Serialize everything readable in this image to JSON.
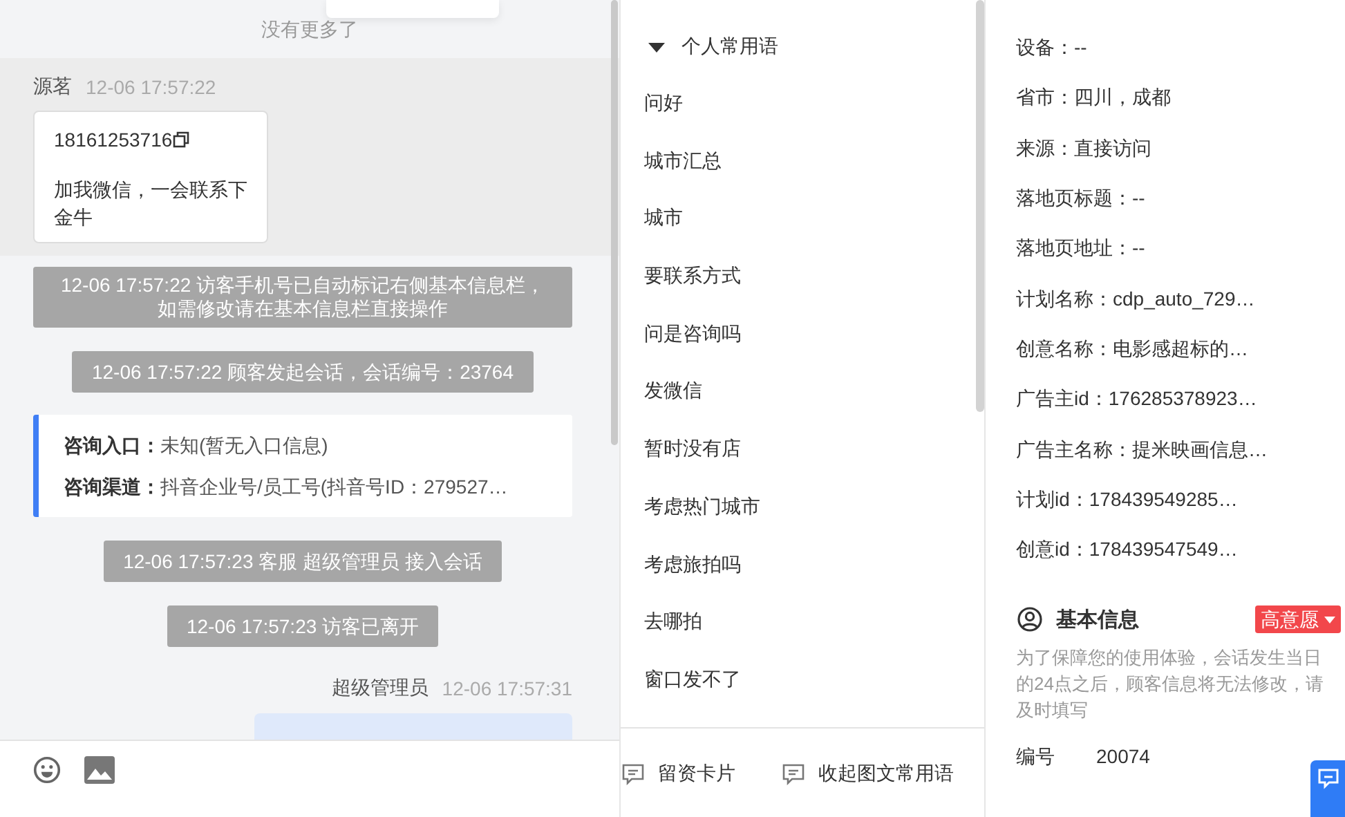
{
  "chat": {
    "history_end": "没有更多了",
    "events": [
      {
        "kind": "visitor_message",
        "sender": "源茗",
        "time": "12-06 17:57:22",
        "phone": "18161253716",
        "text": "加我微信，一会联系下金牛"
      },
      {
        "kind": "notice",
        "text": "12-06 17:57:22 访客手机号已自动标记右侧基本信息栏，如需修改请在基本信息栏直接操作"
      },
      {
        "kind": "notice",
        "text": "12-06 17:57:22 顾客发起会话，会话编号：23764"
      },
      {
        "kind": "info_card",
        "fields": [
          {
            "label": "咨询入口：",
            "value": "未知(暂无入口信息)"
          },
          {
            "label": "咨询渠道：",
            "value": "抖音企业号/员工号(抖音号ID：279527…"
          }
        ]
      },
      {
        "kind": "notice",
        "text": "12-06 17:57:23 客服 超级管理员 接入会话"
      },
      {
        "kind": "notice",
        "text": "12-06 17:57:23 访客已离开"
      },
      {
        "kind": "agent_message",
        "sender": "超级管理员",
        "time": "12-06 17:57:31"
      }
    ]
  },
  "phrases": {
    "title": "个人常用语",
    "expanded": true,
    "items": [
      "问好",
      "城市汇总",
      "城市",
      "要联系方式",
      "问是咨询吗",
      "发微信",
      "暂时没有店",
      "考虑热门城市",
      "考虑旅拍吗",
      "去哪拍",
      "窗口发不了"
    ],
    "actions": [
      "留资卡片",
      "收起图文常用语"
    ]
  },
  "visitor_info": {
    "rows": [
      "设备：--",
      "省市：四川，成都",
      "来源：直接访问",
      "落地页标题：--",
      "落地页地址：--",
      "计划名称：cdp_auto_729…",
      "创意名称：电影感超标的…",
      "广告主id：176285378923…",
      "广告主名称：提米映画信息…",
      "计划id：178439549285…",
      "创意id：178439547549…"
    ]
  },
  "basic_info": {
    "title": "基本信息",
    "intent_tag": "高意愿",
    "note": "为了保障您的使用体验，会话发生当日的24点之后，顾客信息将无法修改，请及时填写",
    "fields": [
      {
        "label": "编号",
        "value": "20074"
      }
    ]
  }
}
